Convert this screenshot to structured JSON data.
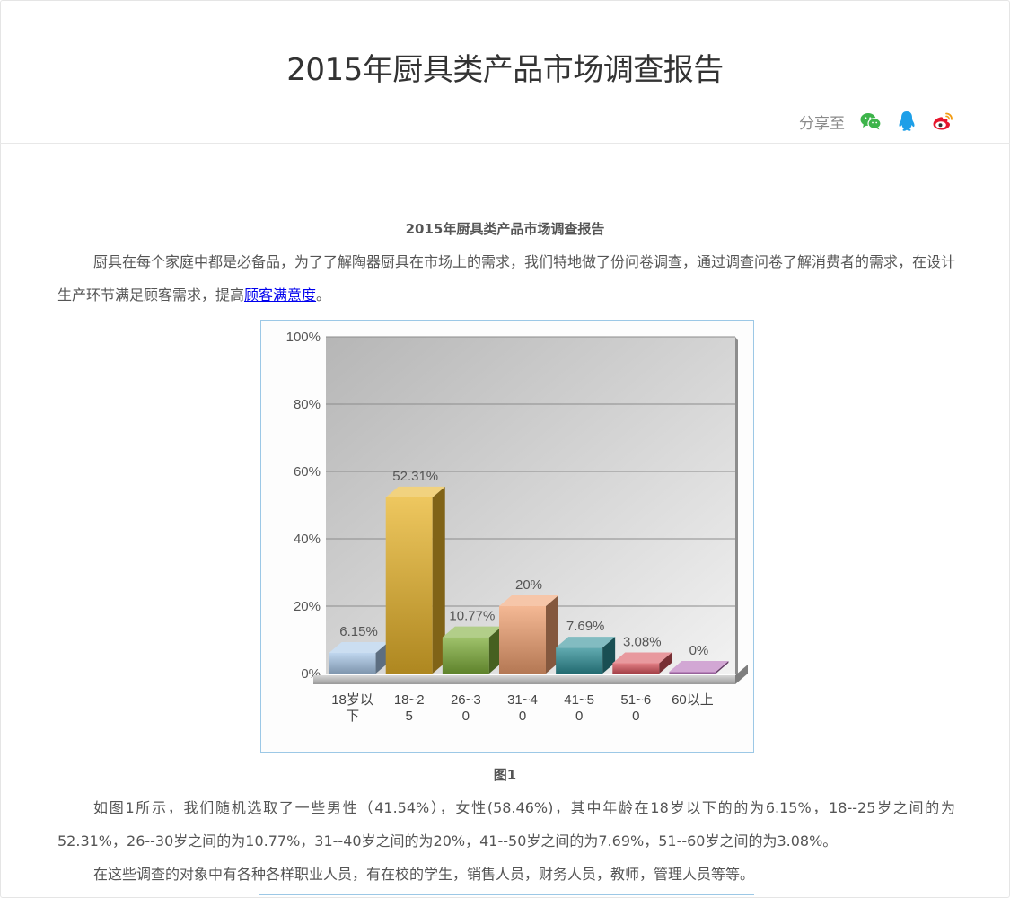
{
  "header": {
    "title": "2015年厨具类产品市场调查报告",
    "share_label": "分享至",
    "share_icons": [
      "wechat-icon",
      "qq-icon",
      "weibo-icon"
    ]
  },
  "article": {
    "title": "2015年厨具类产品市场调查报告",
    "intro_text": "厨具在每个家庭中都是必备品，为了了解陶器厨具在市场上的需求，我们特地做了份问卷调查，通过调查问卷了解消费者的需求，在设计生产环节满足顾客需求，提高",
    "intro_link": "顾客满意度",
    "intro_end": "。",
    "figure_caption": "图1",
    "para2": "如图1所示，我们随机选取了一些男性（41.54%），女性(58.46%)，其中年龄在18岁以下的的为6.15%，18--25岁之间的为52.31%，26--30岁之间的为10.77%，31--40岁之间的为20%，41--50岁之间的为7.69%，51--60岁之间的为3.08%。",
    "para3": "在这些调查的对象中有各种各样职业人员，有在校的学生，销售人员，财务人员，教师，管理人员等等。"
  },
  "chart_data": {
    "type": "bar",
    "categories": [
      "18岁以下",
      "18~25",
      "26~30",
      "31~40",
      "41~50",
      "51~60",
      "60以上"
    ],
    "values": [
      6.15,
      52.31,
      10.77,
      20,
      7.69,
      3.08,
      0
    ],
    "data_labels": [
      "6.15%",
      "52.31%",
      "10.77%",
      "20%",
      "7.69%",
      "3.08%",
      "0%"
    ],
    "y_ticks": [
      "0%",
      "20%",
      "40%",
      "60%",
      "80%",
      "100%"
    ],
    "ylim": [
      0,
      100
    ],
    "grid": true,
    "style": "3d",
    "colors": [
      "#a9c8e8",
      "#e8b42a",
      "#7fae3a",
      "#f0a070",
      "#2e8f97",
      "#d9555e",
      "#b46db8"
    ],
    "title": "",
    "xlabel": "",
    "ylabel": ""
  }
}
